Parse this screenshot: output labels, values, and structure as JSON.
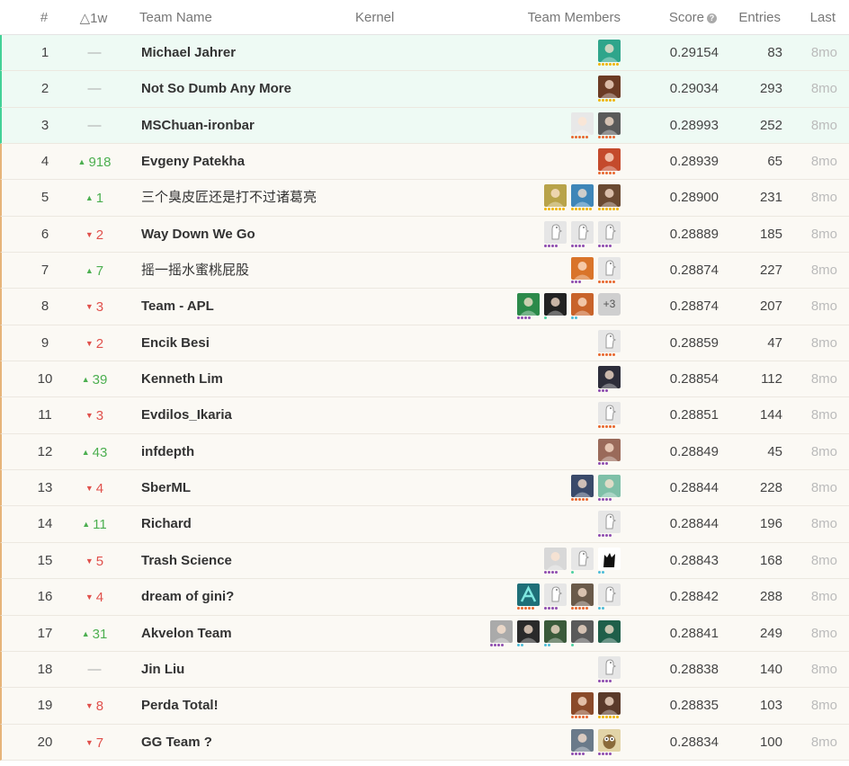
{
  "header": {
    "rank": "#",
    "delta": "△1w",
    "team_name": "Team Name",
    "kernel": "Kernel",
    "team_members": "Team Members",
    "score": "Score",
    "score_help": "?",
    "entries": "Entries",
    "last": "Last"
  },
  "colors": {
    "gold_band": "#eefaf4",
    "gold_border": "#43d197",
    "row_band": "#fbf9f4",
    "row_border": "#e6b47a",
    "up": "#4caf50",
    "down": "#e0514c",
    "tier_novice": "#4cbcd8",
    "tier_contributor": "#8e4cb0",
    "tier_expert": "#e8672f",
    "tier_master": "#f0b400"
  },
  "rows": [
    {
      "rank": "1",
      "delta_dir": "none",
      "delta": "—",
      "team": "Michael Jahrer",
      "bold": true,
      "score": "0.29154",
      "entries": "83",
      "last": "8mo",
      "gold": true,
      "members": [
        {
          "avatar": "teal-avatar-icon",
          "bg": "#2fa58b",
          "dots": [
            "#f0b400",
            "#f0b400",
            "#f0b400",
            "#f0b400",
            "#f0b400",
            "#f0b400"
          ]
        }
      ]
    },
    {
      "rank": "2",
      "delta_dir": "none",
      "delta": "—",
      "team": "Not So Dumb Any More",
      "bold": true,
      "score": "0.29034",
      "entries": "293",
      "last": "8mo",
      "gold": true,
      "members": [
        {
          "avatar": "photo-avatar-icon",
          "bg": "#6b3b24",
          "dots": [
            "#f0b400",
            "#f0b400",
            "#f0b400",
            "#f0b400",
            "#f0b400"
          ]
        }
      ]
    },
    {
      "rank": "3",
      "delta_dir": "none",
      "delta": "—",
      "team": "MSChuan-ironbar",
      "bold": true,
      "score": "0.28993",
      "entries": "252",
      "last": "8mo",
      "gold": true,
      "members": [
        {
          "avatar": "cartoon-avatar-icon",
          "bg": "#e8e8e8",
          "dots": [
            "#e8672f",
            "#e8672f",
            "#e8672f",
            "#e8672f",
            "#e8672f"
          ]
        },
        {
          "avatar": "husky-avatar-icon",
          "bg": "#5a5a5a",
          "dots": [
            "#e8672f",
            "#e8672f",
            "#e8672f",
            "#e8672f",
            "#e8672f"
          ]
        }
      ]
    },
    {
      "rank": "4",
      "delta_dir": "up",
      "delta": "918",
      "team": "Evgeny Patekha",
      "bold": true,
      "score": "0.28939",
      "entries": "65",
      "last": "8mo",
      "members": [
        {
          "avatar": "photo-avatar-icon",
          "bg": "#c44a2c",
          "dots": [
            "#e8672f",
            "#e8672f",
            "#e8672f",
            "#e8672f",
            "#e8672f"
          ]
        }
      ]
    },
    {
      "rank": "5",
      "delta_dir": "up",
      "delta": "1",
      "team": "三个臭皮匠还是打不过诸葛亮",
      "bold": false,
      "score": "0.28900",
      "entries": "231",
      "last": "8mo",
      "members": [
        {
          "avatar": "photo-avatar-icon",
          "bg": "#b8a34a",
          "dots": [
            "#f0b400",
            "#f0b400",
            "#f0b400",
            "#f0b400",
            "#f0b400",
            "#f0b400"
          ]
        },
        {
          "avatar": "photo-avatar-icon",
          "bg": "#3e86b8",
          "dots": [
            "#f0b400",
            "#f0b400",
            "#f0b400",
            "#f0b400",
            "#f0b400",
            "#f0b400"
          ]
        },
        {
          "avatar": "photo-avatar-icon",
          "bg": "#6a4a32",
          "dots": [
            "#f0b400",
            "#f0b400",
            "#f0b400",
            "#f0b400",
            "#f0b400",
            "#f0b400"
          ]
        }
      ]
    },
    {
      "rank": "6",
      "delta_dir": "down",
      "delta": "2",
      "team": "Way Down We Go",
      "bold": true,
      "score": "0.28889",
      "entries": "185",
      "last": "8mo",
      "members": [
        {
          "avatar": "default-goose-avatar-icon",
          "bg": "#e6e6e6",
          "dots": [
            "#8e4cb0",
            "#8e4cb0",
            "#8e4cb0",
            "#8e4cb0"
          ]
        },
        {
          "avatar": "default-goose-avatar-icon",
          "bg": "#e6e6e6",
          "dots": [
            "#8e4cb0",
            "#8e4cb0",
            "#8e4cb0",
            "#8e4cb0"
          ]
        },
        {
          "avatar": "default-goose-avatar-icon",
          "bg": "#e6e6e6",
          "dots": [
            "#8e4cb0",
            "#8e4cb0",
            "#8e4cb0",
            "#8e4cb0"
          ]
        }
      ]
    },
    {
      "rank": "7",
      "delta_dir": "up",
      "delta": "7",
      "team": "摇一摇水蜜桃屁股",
      "bold": false,
      "score": "0.28874",
      "entries": "227",
      "last": "8mo",
      "members": [
        {
          "avatar": "photo-avatar-icon",
          "bg": "#d9742a",
          "dots": [
            "#8e4cb0",
            "#8e4cb0",
            "#8e4cb0"
          ]
        },
        {
          "avatar": "default-goose-avatar-icon",
          "bg": "#e6e6e6",
          "dots": [
            "#e8672f",
            "#e8672f",
            "#e8672f",
            "#e8672f",
            "#e8672f"
          ]
        }
      ]
    },
    {
      "rank": "8",
      "delta_dir": "down",
      "delta": "3",
      "team": "Team - APL",
      "bold": true,
      "score": "0.28874",
      "entries": "207",
      "last": "8mo",
      "members": [
        {
          "avatar": "photo-avatar-icon",
          "bg": "#2c8a4a",
          "dots": [
            "#8e4cb0",
            "#8e4cb0",
            "#8e4cb0",
            "#8e4cb0"
          ]
        },
        {
          "avatar": "photo-avatar-icon",
          "bg": "#222222",
          "dots": [
            "#4cd0a0"
          ]
        },
        {
          "avatar": "photo-avatar-icon",
          "bg": "#c8632a",
          "dots": [
            "#4cbcd8",
            "#4cbcd8"
          ]
        },
        {
          "avatar": "more-members-icon",
          "plus": "+3",
          "dots": []
        }
      ]
    },
    {
      "rank": "9",
      "delta_dir": "down",
      "delta": "2",
      "team": "Encik Besi",
      "bold": true,
      "score": "0.28859",
      "entries": "47",
      "last": "8mo",
      "members": [
        {
          "avatar": "default-goose-avatar-icon",
          "bg": "#e6e6e6",
          "dots": [
            "#e8672f",
            "#e8672f",
            "#e8672f",
            "#e8672f",
            "#e8672f"
          ]
        }
      ]
    },
    {
      "rank": "10",
      "delta_dir": "up",
      "delta": "39",
      "team": "Kenneth Lim",
      "bold": true,
      "score": "0.28854",
      "entries": "112",
      "last": "8mo",
      "members": [
        {
          "avatar": "photo-avatar-icon",
          "bg": "#2d2d3a",
          "dots": [
            "#8e4cb0",
            "#8e4cb0",
            "#8e4cb0"
          ]
        }
      ]
    },
    {
      "rank": "11",
      "delta_dir": "down",
      "delta": "3",
      "team": "Evdilos_Ikaria",
      "bold": true,
      "score": "0.28851",
      "entries": "144",
      "last": "8mo",
      "members": [
        {
          "avatar": "default-goose-avatar-icon",
          "bg": "#e6e6e6",
          "dots": [
            "#e8672f",
            "#e8672f",
            "#e8672f",
            "#e8672f",
            "#e8672f"
          ]
        }
      ]
    },
    {
      "rank": "12",
      "delta_dir": "up",
      "delta": "43",
      "team": "infdepth",
      "bold": true,
      "score": "0.28849",
      "entries": "45",
      "last": "8mo",
      "members": [
        {
          "avatar": "photo-avatar-icon",
          "bg": "#9a6a5a",
          "dots": [
            "#8e4cb0",
            "#8e4cb0",
            "#8e4cb0"
          ]
        }
      ]
    },
    {
      "rank": "13",
      "delta_dir": "down",
      "delta": "4",
      "team": "SberML",
      "bold": true,
      "score": "0.28844",
      "entries": "228",
      "last": "8mo",
      "members": [
        {
          "avatar": "photo-avatar-icon",
          "bg": "#3a4a6a",
          "dots": [
            "#e8672f",
            "#e8672f",
            "#e8672f",
            "#e8672f",
            "#e8672f"
          ]
        },
        {
          "avatar": "photo-avatar-icon",
          "bg": "#7fc0a8",
          "dots": [
            "#8e4cb0",
            "#8e4cb0",
            "#8e4cb0",
            "#8e4cb0"
          ]
        }
      ]
    },
    {
      "rank": "14",
      "delta_dir": "up",
      "delta": "11",
      "team": "Richard",
      "bold": true,
      "score": "0.28844",
      "entries": "196",
      "last": "8mo",
      "members": [
        {
          "avatar": "default-goose-avatar-icon",
          "bg": "#e6e6e6",
          "dots": [
            "#8e4cb0",
            "#8e4cb0",
            "#8e4cb0",
            "#8e4cb0"
          ]
        }
      ]
    },
    {
      "rank": "15",
      "delta_dir": "down",
      "delta": "5",
      "team": "Trash Science",
      "bold": true,
      "score": "0.28843",
      "entries": "168",
      "last": "8mo",
      "members": [
        {
          "avatar": "photo-avatar-icon",
          "bg": "#d8d8d8",
          "dots": [
            "#8e4cb0",
            "#8e4cb0",
            "#8e4cb0",
            "#8e4cb0"
          ]
        },
        {
          "avatar": "default-goose-avatar-icon",
          "bg": "#e6e6e6",
          "dots": [
            "#4cd0a0"
          ]
        },
        {
          "avatar": "black-cat-avatar-icon",
          "bg": "#ffffff",
          "dots": [
            "#4cbcd8",
            "#4cbcd8"
          ]
        }
      ]
    },
    {
      "rank": "16",
      "delta_dir": "down",
      "delta": "4",
      "team": "dream of gini?",
      "bold": true,
      "score": "0.28842",
      "entries": "288",
      "last": "8mo",
      "members": [
        {
          "avatar": "logo-avatar-icon",
          "bg": "#1f6f78",
          "dots": [
            "#e8672f",
            "#e8672f",
            "#e8672f",
            "#e8672f",
            "#e8672f"
          ]
        },
        {
          "avatar": "default-goose-avatar-icon",
          "bg": "#e6e6e6",
          "dots": [
            "#8e4cb0",
            "#8e4cb0",
            "#8e4cb0",
            "#8e4cb0"
          ]
        },
        {
          "avatar": "photo-avatar-icon",
          "bg": "#6a5a4a",
          "dots": [
            "#e8672f",
            "#e8672f",
            "#e8672f",
            "#e8672f",
            "#e8672f"
          ]
        },
        {
          "avatar": "default-goose-avatar-icon",
          "bg": "#e6e6e6",
          "dots": [
            "#4cbcd8",
            "#4cbcd8"
          ]
        }
      ]
    },
    {
      "rank": "17",
      "delta_dir": "up",
      "delta": "31",
      "team": "Akvelon Team",
      "bold": true,
      "score": "0.28841",
      "entries": "249",
      "last": "8mo",
      "members": [
        {
          "avatar": "photo-avatar-icon",
          "bg": "#aaaaaa",
          "dots": [
            "#8e4cb0",
            "#8e4cb0",
            "#8e4cb0",
            "#8e4cb0"
          ]
        },
        {
          "avatar": "photo-avatar-icon",
          "bg": "#2a2a2a",
          "dots": [
            "#4cbcd8",
            "#4cbcd8"
          ]
        },
        {
          "avatar": "photo-avatar-icon",
          "bg": "#3a5a3a",
          "dots": [
            "#4cbcd8",
            "#4cbcd8"
          ]
        },
        {
          "avatar": "photo-avatar-icon",
          "bg": "#5a5a5a",
          "dots": [
            "#4cd0a0"
          ]
        },
        {
          "avatar": "photo-avatar-icon",
          "bg": "#1f5f4a",
          "dots": []
        }
      ]
    },
    {
      "rank": "18",
      "delta_dir": "none",
      "delta": "—",
      "team": "Jin Liu",
      "bold": true,
      "score": "0.28838",
      "entries": "140",
      "last": "8mo",
      "members": [
        {
          "avatar": "default-goose-avatar-icon",
          "bg": "#e6e6e6",
          "dots": [
            "#8e4cb0",
            "#8e4cb0",
            "#8e4cb0",
            "#8e4cb0"
          ]
        }
      ]
    },
    {
      "rank": "19",
      "delta_dir": "down",
      "delta": "8",
      "team": "Perda Total!",
      "bold": true,
      "score": "0.28835",
      "entries": "103",
      "last": "8mo",
      "members": [
        {
          "avatar": "photo-avatar-icon",
          "bg": "#8a4a2a",
          "dots": [
            "#e8672f",
            "#e8672f",
            "#e8672f",
            "#e8672f",
            "#e8672f"
          ]
        },
        {
          "avatar": "photo-avatar-icon",
          "bg": "#5a3a2a",
          "dots": [
            "#f0b400",
            "#f0b400",
            "#f0b400",
            "#f0b400",
            "#f0b400",
            "#f0b400"
          ]
        }
      ]
    },
    {
      "rank": "20",
      "delta_dir": "down",
      "delta": "7",
      "team": "GG Team ?",
      "bold": true,
      "score": "0.28834",
      "entries": "100",
      "last": "8mo",
      "members": [
        {
          "avatar": "photo-avatar-icon",
          "bg": "#6a7a8a",
          "dots": [
            "#8e4cb0",
            "#8e4cb0",
            "#8e4cb0",
            "#8e4cb0"
          ]
        },
        {
          "avatar": "owl-avatar-icon",
          "bg": "#e2d4a8",
          "dots": [
            "#8e4cb0",
            "#8e4cb0",
            "#8e4cb0",
            "#8e4cb0"
          ]
        }
      ]
    }
  ]
}
